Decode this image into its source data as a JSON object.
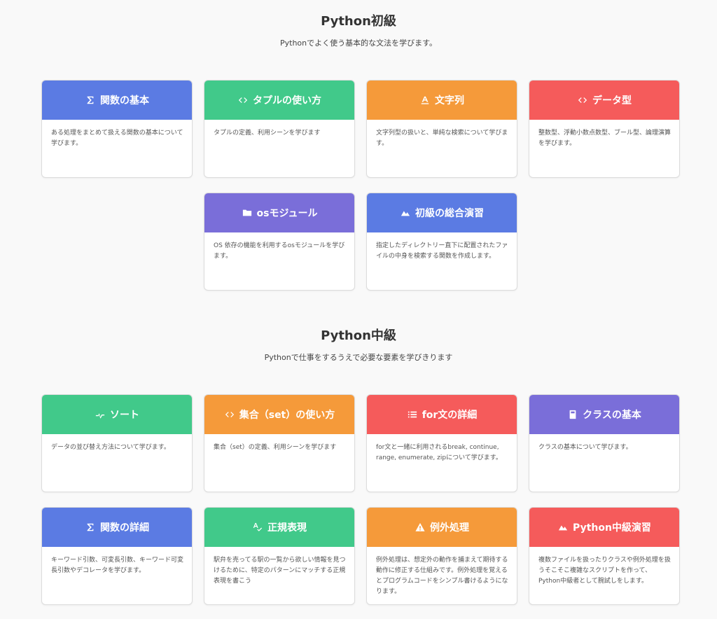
{
  "colors": {
    "blue": "#5b7be3",
    "green": "#41c98a",
    "orange": "#f59a3a",
    "red": "#f55b5b",
    "purple": "#7a6ed9"
  },
  "sections": [
    {
      "title": "Python初級",
      "description": "Pythonでよく使う基本的な文法を学びます。",
      "cards": [
        {
          "title": "関数の基本",
          "icon": "sigma-icon",
          "color": "blue",
          "description": "ある処理をまとめて扱える関数の基本について学びます。"
        },
        {
          "title": "タプルの使い方",
          "icon": "code-icon",
          "color": "green",
          "description": "タプルの定義、利用シーンを学びます"
        },
        {
          "title": "文字列",
          "icon": "text-icon",
          "color": "orange",
          "description": "文字列型の扱いと、単純な検索について学びます。"
        },
        {
          "title": "データ型",
          "icon": "code-icon",
          "color": "red",
          "description": "整数型、浮動小数点数型、ブール型、論理演算を学びます。"
        },
        {
          "title": "osモジュール",
          "icon": "folder-icon",
          "color": "purple",
          "description": "OS 依存の機能を利用するosモジュールを学びます。"
        },
        {
          "title": "初級の総合演習",
          "icon": "mountain-icon",
          "color": "blue",
          "description": "指定したディレクトリー直下に配置されたファイルの中身を検索する関数を作成します。"
        }
      ]
    },
    {
      "title": "Python中級",
      "description": "Pythonで仕事をするうえで必要な要素を学びきります",
      "cards": [
        {
          "title": "ソート",
          "icon": "sort-icon",
          "color": "green",
          "description": "データの並び替え方法について学びます。"
        },
        {
          "title": "集合（set）の使い方",
          "icon": "code-icon",
          "color": "orange",
          "description": "集合（set）の定義、利用シーンを学びます"
        },
        {
          "title": "for文の詳細",
          "icon": "list-icon",
          "color": "red",
          "description": "for文と一緒に利用されるbreak, continue, range, enumerate, zipについて学びます。"
        },
        {
          "title": "クラスの基本",
          "icon": "book-icon",
          "color": "purple",
          "description": "クラスの基本について学びます。"
        },
        {
          "title": "関数の詳細",
          "icon": "sigma-icon",
          "color": "blue",
          "description": "キーワード引数、可変長引数、キーワード可変長引数やデコレータを学びます。"
        },
        {
          "title": "正規表現",
          "icon": "spellcheck-icon",
          "color": "green",
          "description": "駅弁を売ってる駅の一覧から欲しい情報を見つけるために、特定のパターンにマッチする正規表現を書こう"
        },
        {
          "title": "例外処理",
          "icon": "warning-icon",
          "color": "orange",
          "description": "例外処理は、想定外の動作を捕まえて期待する動作に修正する仕組みです。例外処理を覚えるとプログラムコードをシンプル書けるようになります。"
        },
        {
          "title": "Python中級演習",
          "icon": "mountain-icon",
          "color": "red",
          "description": "複数ファイルを扱ったりクラスや例外処理を扱うそこそこ複雑なスクリプトを作って、Python中級者として腕試しをします。"
        }
      ]
    }
  ]
}
